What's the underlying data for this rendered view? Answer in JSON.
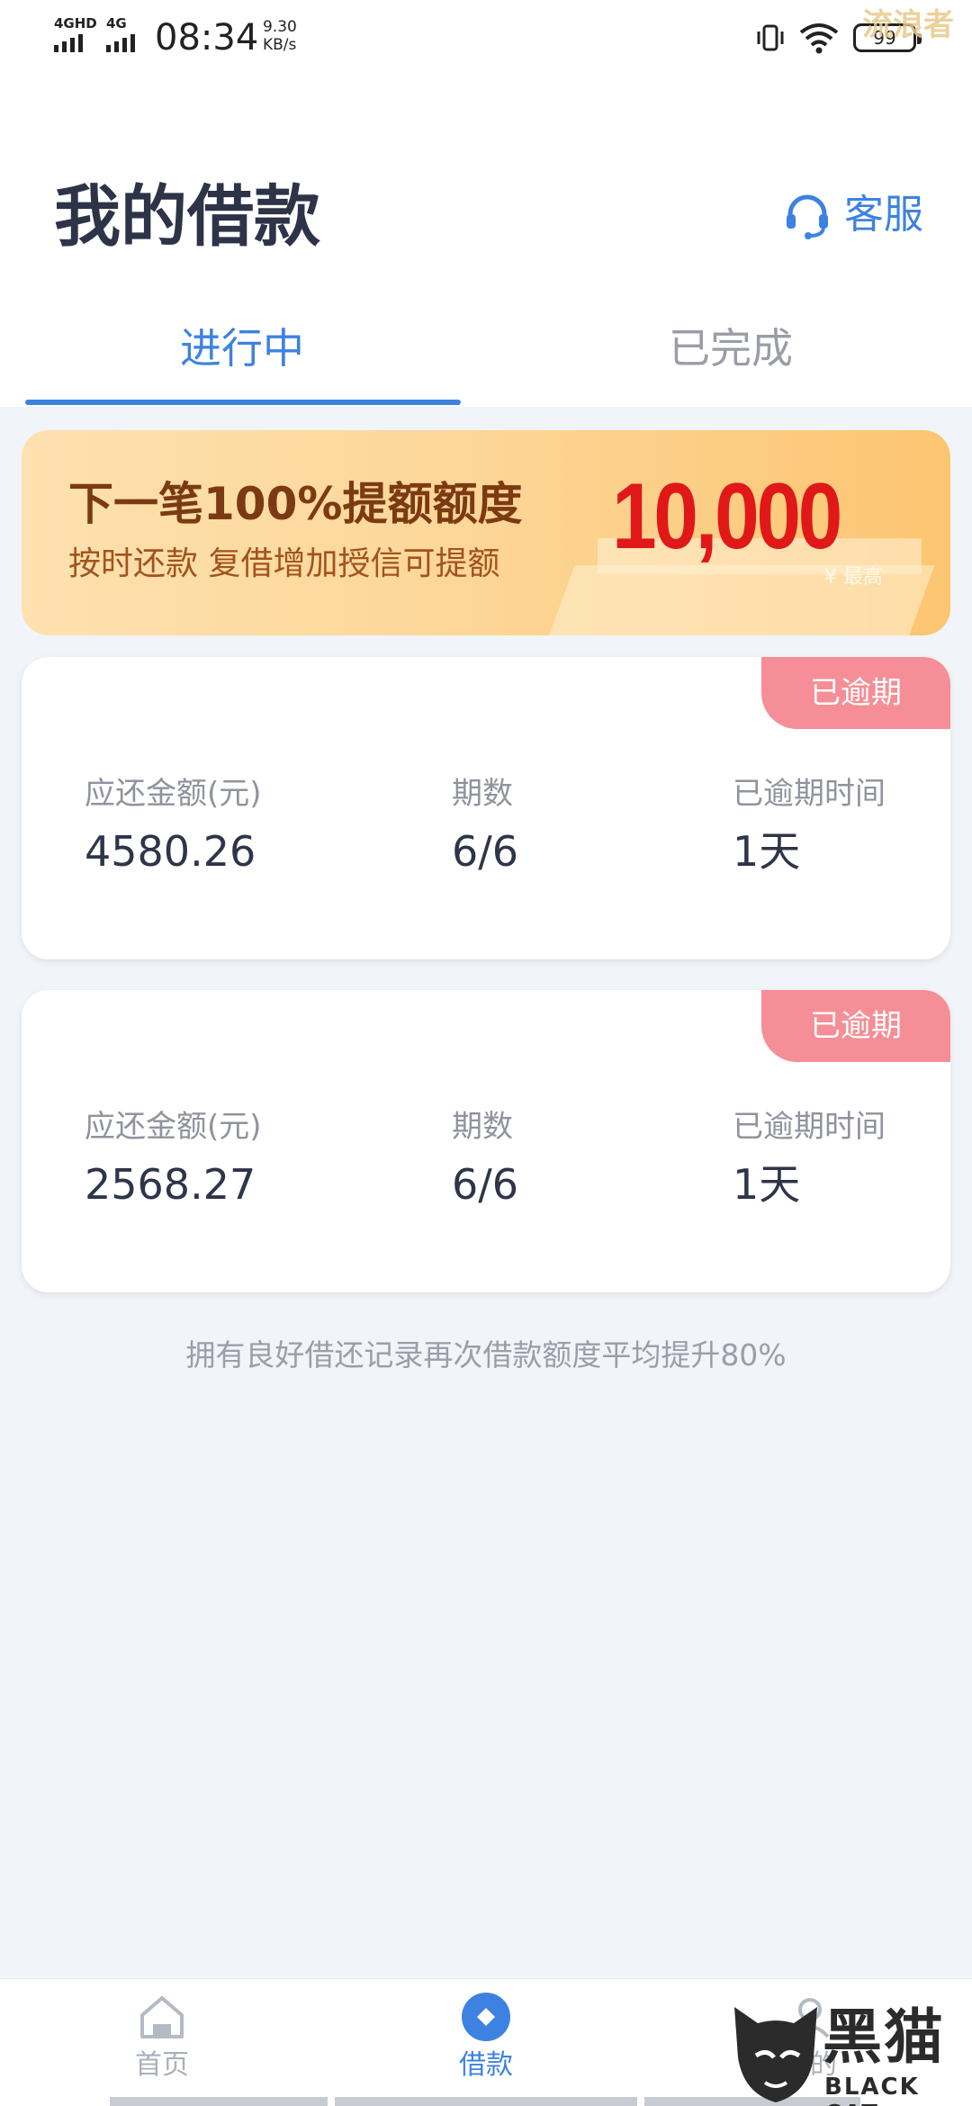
{
  "status_bar": {
    "signal_1": "4GHD",
    "signal_2": "4G",
    "time": "08:34",
    "speed_value": "9.30",
    "speed_unit": "KB/s",
    "battery": "99",
    "watermark_text": "流浪者"
  },
  "header": {
    "title": "我的借款",
    "service_label": "客服"
  },
  "tabs": [
    {
      "label": "进行中",
      "active": true
    },
    {
      "label": "已完成",
      "active": false
    }
  ],
  "banner": {
    "headline": "下一笔100%提额额度",
    "subline": "按时还款  复借增加授信可提额",
    "amount": "10,000",
    "amount_note": "¥ 最高"
  },
  "loans": [
    {
      "badge": "已逾期",
      "amount_label": "应还金额(元)",
      "amount": "4580.26",
      "periods_label": "期数",
      "periods": "6/6",
      "overdue_label": "已逾期时间",
      "overdue": "1天"
    },
    {
      "badge": "已逾期",
      "amount_label": "应还金额(元)",
      "amount": "2568.27",
      "periods_label": "期数",
      "periods": "6/6",
      "overdue_label": "已逾期时间",
      "overdue": "1天"
    }
  ],
  "footnote": "拥有良好借还记录再次借款额度平均提升80%",
  "bottom_nav": [
    {
      "label": "首页",
      "icon": "home-icon",
      "active": false
    },
    {
      "label": "借款",
      "icon": "loan-icon",
      "active": true
    },
    {
      "label": "我的",
      "icon": "profile-icon",
      "active": false
    }
  ],
  "watermark": {
    "zh": "黑猫",
    "en": "BLACK CAT"
  },
  "colors": {
    "accent": "#3d82e0",
    "overdue_badge": "#f58e96",
    "banner_amount": "#e01818",
    "background": "#f1f4f8"
  }
}
